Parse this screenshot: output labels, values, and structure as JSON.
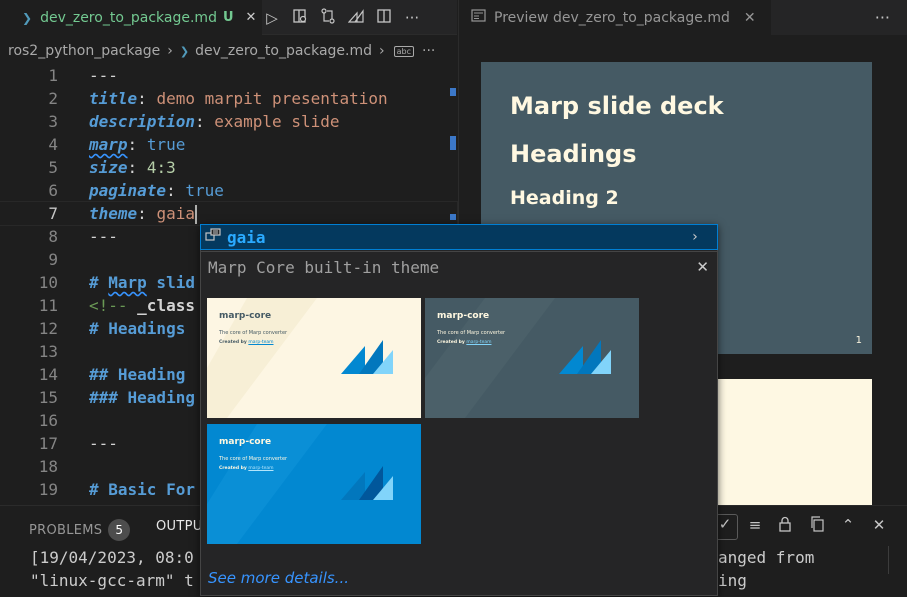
{
  "editor": {
    "tab": {
      "icon": "markdown-icon",
      "label": "dev_zero_to_package.md",
      "status": "U",
      "close": "✕"
    },
    "toolbar_icons": [
      "run-icon",
      "open-preview-icon",
      "compare-changes-icon",
      "marp-icon",
      "split-editor-icon",
      "more-actions-icon"
    ],
    "breadcrumb": {
      "folder": "ros2_python_package",
      "file": "dev_zero_to_package.md",
      "symbol_icon": "abc",
      "more": "···"
    },
    "lines": [
      {
        "num": "1"
      },
      {
        "num": "2"
      },
      {
        "num": "3"
      },
      {
        "num": "4"
      },
      {
        "num": "5"
      },
      {
        "num": "6"
      },
      {
        "num": "7"
      },
      {
        "num": "8"
      },
      {
        "num": "9"
      },
      {
        "num": "10"
      },
      {
        "num": "11"
      },
      {
        "num": "12"
      },
      {
        "num": "13"
      },
      {
        "num": "14"
      },
      {
        "num": "15"
      },
      {
        "num": "16"
      },
      {
        "num": "17"
      },
      {
        "num": "18"
      },
      {
        "num": "19"
      }
    ],
    "code": {
      "l1": "---",
      "l2_key": "title",
      "l2_val": "demo marpit presentation",
      "l3_key": "description",
      "l3_val": "example slide",
      "l4_key": "marp",
      "l4_val": "true",
      "l5_key": "size",
      "l5_val": "4:3",
      "l6_key": "paginate",
      "l6_val": "true",
      "l7_key": "theme",
      "l7_val": "gaia",
      "l8": "---",
      "l10_hash": "# ",
      "l10_word": "Marp",
      "l10_rest": " slid",
      "l11_open": "<!-- ",
      "l11_rest": "_class",
      "l12": "# Headings",
      "l14": "## Heading",
      "l15": "### Heading",
      "l17": "---",
      "l19": "# Basic For"
    },
    "colon": ":"
  },
  "preview": {
    "tab": {
      "icon": "preview-icon",
      "label": "Preview dev_zero_to_package.md",
      "close": "✕"
    },
    "more": "···",
    "slide1": {
      "h1": "Marp slide deck",
      "h1b": "Headings",
      "h2": "Heading 2",
      "page": "1"
    }
  },
  "panel": {
    "tabs": {
      "problems": "PROBLEMS",
      "problems_count": "5",
      "output": "OUTPUT"
    },
    "output_lines": {
      "l1_left": "[19/04/2023, 08:0",
      "l1_right": "anged from",
      "l2_left": "\"linux-gcc-arm\" t",
      "l2_right": "ing"
    }
  },
  "hover": {
    "suggestion": {
      "icon": "enum-member-icon",
      "label": "gaia",
      "chevron": "›"
    },
    "detail_title": "Marp Core built-in theme",
    "close": "✕",
    "themes": [
      {
        "title": "marp-core",
        "subtitle": "The core of Marp converter",
        "by": "Created by",
        "author": "marp-team",
        "bg": "#fdf6e3",
        "fg": "#455a64"
      },
      {
        "title": "marp-core",
        "subtitle": "The core of Marp converter",
        "by": "Created by",
        "author": "marp-team",
        "bg": "#455a64",
        "fg": "#fff8e1"
      },
      {
        "title": "marp-core",
        "subtitle": "The core of Marp converter",
        "by": "Created by",
        "author": "marp-team",
        "bg": "#0288d1",
        "fg": "#fff8e1"
      }
    ],
    "more_details": "See more details..."
  },
  "colors": {
    "accent": "#007fd4",
    "selection": "#04395e",
    "link": "#3794ff",
    "git_untracked": "#73c991"
  }
}
